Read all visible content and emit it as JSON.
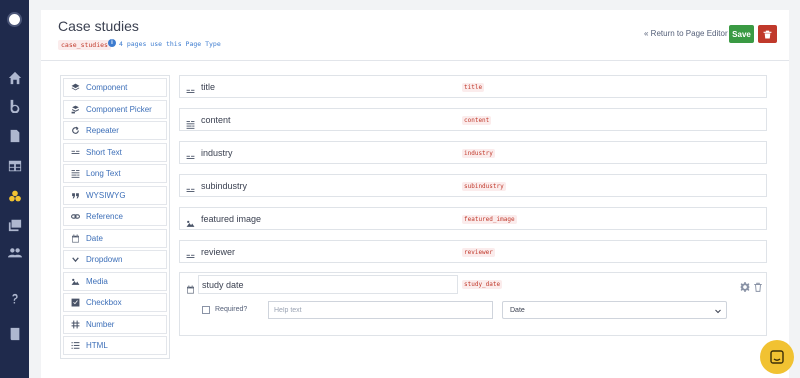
{
  "header": {
    "title": "Case studies",
    "slug": "case_studies",
    "usage_note": "4 pages use this Page Type",
    "return_link": "« Return to Page Editor",
    "save_label": "Save"
  },
  "palette": [
    {
      "label": "Component",
      "icon": "layers-icon"
    },
    {
      "label": "Component Picker",
      "icon": "component-picker-icon"
    },
    {
      "label": "Repeater",
      "icon": "repeat-icon"
    },
    {
      "label": "Short Text",
      "icon": "short-text-icon"
    },
    {
      "label": "Long Text",
      "icon": "long-text-icon"
    },
    {
      "label": "WYSIWYG",
      "icon": "quote-icon"
    },
    {
      "label": "Reference",
      "icon": "link-icon"
    },
    {
      "label": "Date",
      "icon": "calendar-icon"
    },
    {
      "label": "Dropdown",
      "icon": "chevron-down-icon"
    },
    {
      "label": "Media",
      "icon": "image-icon"
    },
    {
      "label": "Checkbox",
      "icon": "checkbox-icon"
    },
    {
      "label": "Number",
      "icon": "hash-icon"
    },
    {
      "label": "HTML",
      "icon": "list-icon"
    }
  ],
  "fields": [
    {
      "name": "title",
      "slug": "title",
      "icon": "short-text-icon"
    },
    {
      "name": "content",
      "slug": "content",
      "icon": "long-text-icon"
    },
    {
      "name": "industry",
      "slug": "industry",
      "icon": "short-text-icon"
    },
    {
      "name": "subindustry",
      "slug": "subindustry",
      "icon": "short-text-icon"
    },
    {
      "name": "featured image",
      "slug": "featured_image",
      "icon": "image-icon"
    },
    {
      "name": "reviewer",
      "slug": "reviewer",
      "icon": "short-text-icon"
    }
  ],
  "expanded_field": {
    "name": "study date",
    "slug": "study_date",
    "icon": "calendar-icon",
    "required_label": "Required?",
    "help_placeholder": "Help text",
    "type_value": "Date"
  },
  "colors": {
    "rail": "#1f2a4c",
    "accent": "#3d7ccf",
    "save": "#3a9a43",
    "delete": "#c0392b",
    "chat": "#f1c232"
  }
}
